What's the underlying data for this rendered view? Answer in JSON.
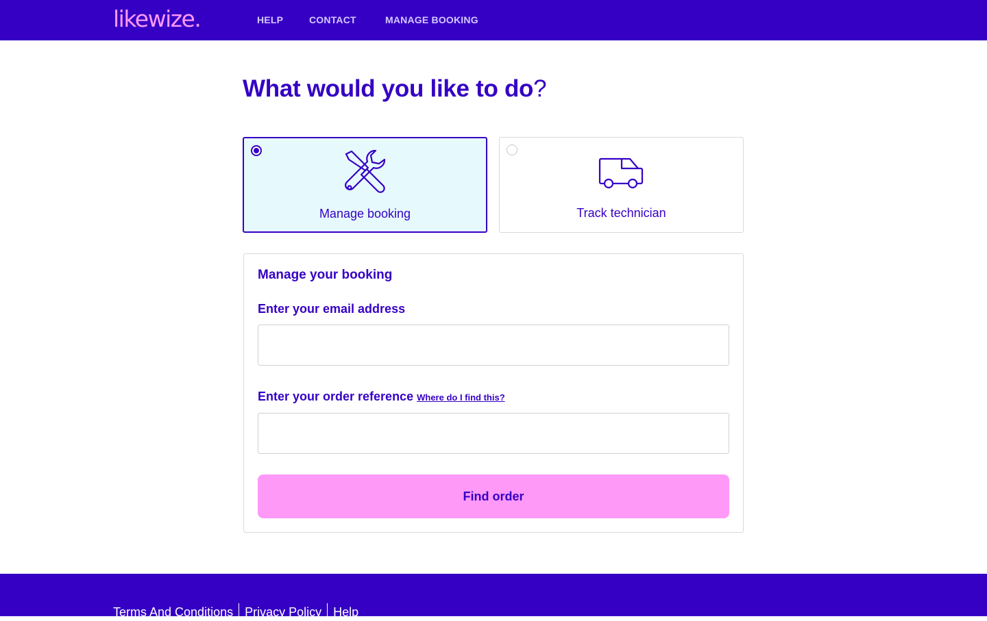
{
  "header": {
    "logo": "likewize.",
    "nav": [
      {
        "label": "HELP"
      },
      {
        "label": "CONTACT"
      },
      {
        "label": "MANAGE BOOKING"
      }
    ]
  },
  "heading": {
    "text": "What would you like to do",
    "question_mark": "?"
  },
  "options": [
    {
      "label": "Manage booking",
      "icon": "tools-icon",
      "selected": true
    },
    {
      "label": "Track technician",
      "icon": "van-icon",
      "selected": false
    }
  ],
  "form": {
    "title": "Manage your booking",
    "email_label": "Enter your email address",
    "email_value": "",
    "order_label": "Enter your order reference",
    "order_help_link": "Where do I find this?",
    "order_value": "",
    "submit_label": "Find order"
  },
  "footer": {
    "links": [
      {
        "label": "Terms And Conditions"
      },
      {
        "label": "Privacy Policy"
      },
      {
        "label": "Help"
      }
    ]
  },
  "colors": {
    "brand": "#3500c4",
    "accent_pink": "#ff99f8",
    "selected_bg": "#e6f9fc"
  }
}
